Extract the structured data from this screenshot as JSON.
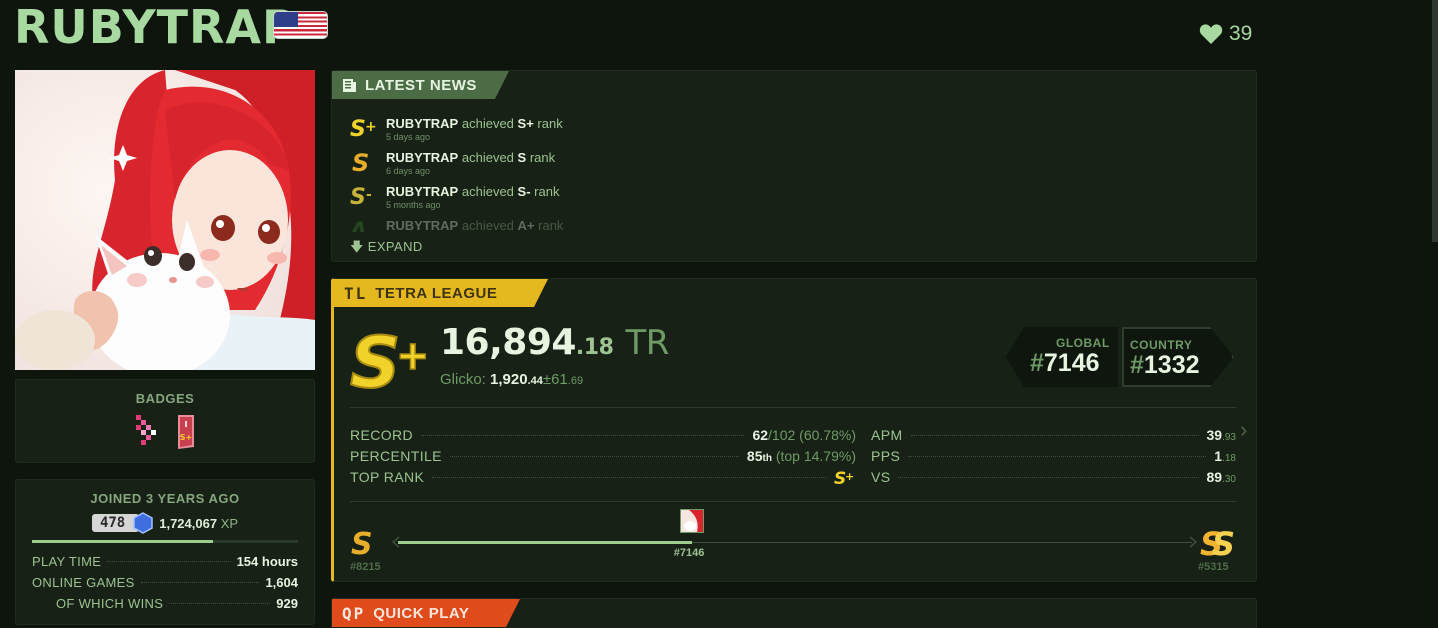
{
  "profile": {
    "username": "RUBYTRAP",
    "likes": "39",
    "icons": {
      "flag": "us-flag-icon",
      "heart": "heart-icon"
    }
  },
  "badges": {
    "title": "BADGES"
  },
  "account": {
    "joined": "JOINED 3 YEARS AGO",
    "level": "478",
    "xp_value": "1,724,067",
    "xp_unit": "XP",
    "level_progress": 0.68,
    "stats": [
      {
        "label": "PLAY TIME",
        "value": "154 hours"
      },
      {
        "label": "ONLINE GAMES",
        "value": "1,604"
      },
      {
        "label": "OF WHICH WINS",
        "value": "929"
      }
    ]
  },
  "news": {
    "title": "LATEST NEWS",
    "items": [
      {
        "rank": "S+",
        "user": "RUBYTRAP",
        "verb": "achieved",
        "rank_text": "S+",
        "suffix": "rank",
        "ago": "5 days ago",
        "color": "#f0d22a"
      },
      {
        "rank": "S",
        "user": "RUBYTRAP",
        "verb": "achieved",
        "rank_text": "S",
        "suffix": "rank",
        "ago": "6 days ago",
        "color": "#e6ae2a"
      },
      {
        "rank": "S-",
        "user": "RUBYTRAP",
        "verb": "achieved",
        "rank_text": "S-",
        "suffix": "rank",
        "ago": "5 months ago",
        "color": "#c7b23a"
      },
      {
        "rank": "A+",
        "user": "RUBYTRAP",
        "verb": "achieved",
        "rank_text": "A+",
        "suffix": "rank",
        "ago": "",
        "color": "#3f8a35"
      }
    ],
    "expand": "EXPAND"
  },
  "league": {
    "tab_icon": "TL",
    "title": "TETRA LEAGUE",
    "tr_int": "16,894",
    "tr_dec": ".18",
    "tr_unit": "TR",
    "glicko_label": "Glicko:",
    "glicko_int": "1,920",
    "glicko_dec": ".44",
    "glicko_pm": "±61",
    "glicko_pm_dec": ".69",
    "global_label": "GLOBAL",
    "global_rank": "7146",
    "country_label": "COUNTRY",
    "country_rank": "1332",
    "hash": "#",
    "record_label": "RECORD",
    "record_wins": "62",
    "record_rest": "/102 (60.78%)",
    "percentile_label": "PERCENTILE",
    "percentile_val": "85",
    "percentile_suffix": "th",
    "percentile_rest": "(top 14.79%)",
    "toprank_label": "TOP RANK",
    "apm_label": "APM",
    "apm_int": "39",
    "apm_dec": ".93",
    "pps_label": "PPS",
    "pps_int": "1",
    "pps_dec": ".18",
    "vs_label": "VS",
    "vs_int": "89",
    "vs_dec": ".30",
    "prev_rank_pos": "#8215",
    "current_pos": "#7146",
    "next_rank_pos": "#5315",
    "progress": 0.37
  },
  "quickplay": {
    "tab_icon": "QP",
    "title": "QUICK PLAY"
  }
}
